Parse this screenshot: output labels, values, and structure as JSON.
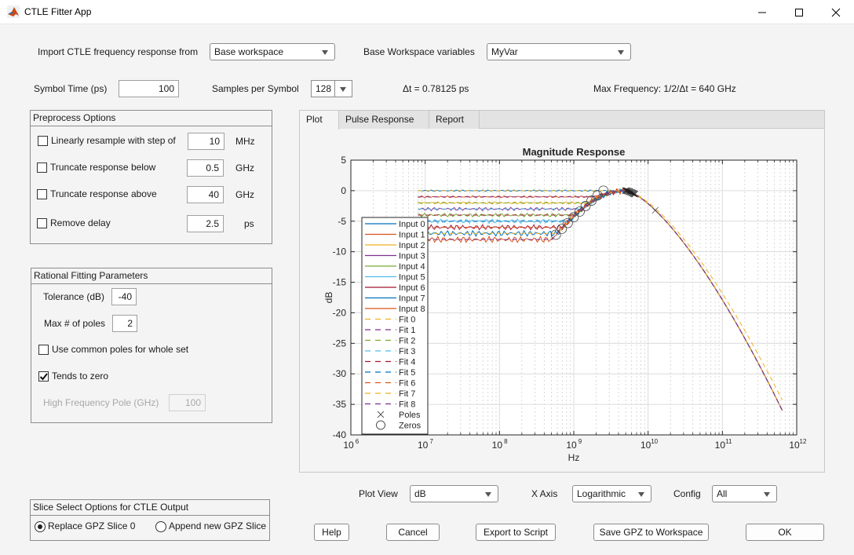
{
  "window": {
    "title": "CTLE Fitter App",
    "icon": "matlab-logo-icon",
    "controls": {
      "minimize": "minimize-icon",
      "maximize": "maximize-icon",
      "close": "close-icon"
    }
  },
  "import": {
    "label": "Import CTLE frequency response from",
    "source_value": "Base workspace",
    "variables_label": "Base Workspace variables",
    "variables_value": "MyVar"
  },
  "symbol": {
    "time_label": "Symbol Time (ps)",
    "time_value": "100",
    "samples_label": "Samples per Symbol",
    "samples_value": "128",
    "delta_t": "Δt = 0.78125 ps",
    "max_freq": "Max Frequency: 1/2/Δt = 640 GHz"
  },
  "preprocess": {
    "title": "Preprocess Options",
    "options": [
      {
        "label": "Linearly resample with step of",
        "checked": false,
        "value": "10",
        "unit": "MHz"
      },
      {
        "label": "Truncate response below",
        "checked": false,
        "value": "0.5",
        "unit": "GHz"
      },
      {
        "label": "Truncate response above",
        "checked": false,
        "value": "40",
        "unit": "GHz"
      },
      {
        "label": "Remove delay",
        "checked": false,
        "value": "2.5",
        "unit": "ps"
      }
    ]
  },
  "rational": {
    "title": "Rational Fitting Parameters",
    "tolerance_label": "Tolerance (dB)",
    "tolerance_value": "-40",
    "maxpoles_label": "Max # of poles",
    "maxpoles_value": "2",
    "common_poles_label": "Use common poles for whole set",
    "common_poles_checked": false,
    "tends_zero_label": "Tends to zero",
    "tends_zero_checked": true,
    "hf_pole_label": "High Frequency Pole (GHz)",
    "hf_pole_value": "100"
  },
  "slice": {
    "title": "Slice Select Options for CTLE Output",
    "options": [
      {
        "label": "Replace GPZ Slice 0",
        "selected": true
      },
      {
        "label": "Append new GPZ Slice",
        "selected": false
      }
    ]
  },
  "tabs": [
    {
      "label": "Plot",
      "active": true
    },
    {
      "label": "Pulse Response",
      "active": false
    },
    {
      "label": "Report",
      "active": false
    }
  ],
  "plot_controls": {
    "view_label": "Plot View",
    "view_value": "dB",
    "xaxis_label": "X Axis",
    "xaxis_value": "Logarithmic",
    "config_label": "Config",
    "config_value": "All"
  },
  "buttons": {
    "help": "Help",
    "cancel": "Cancel",
    "export": "Export to Script",
    "save": "Save GPZ to Workspace",
    "ok": "OK"
  },
  "chart_data": {
    "type": "line",
    "title": "Magnitude Response",
    "xlabel": "Hz",
    "ylabel": "dB",
    "xscale": "log",
    "xlim": [
      1000000.0,
      1000000000000.0
    ],
    "ylim": [
      -40,
      5
    ],
    "xticks": [
      {
        "exp": "6",
        "value": 1000000.0
      },
      {
        "exp": "7",
        "value": 10000000.0
      },
      {
        "exp": "8",
        "value": 100000000.0
      },
      {
        "exp": "9",
        "value": 1000000000.0
      },
      {
        "exp": "10",
        "value": 10000000000.0
      },
      {
        "exp": "11",
        "value": 100000000000.0
      },
      {
        "exp": "12",
        "value": 1000000000000.0
      }
    ],
    "yticks": [
      5,
      0,
      -5,
      -10,
      -15,
      -20,
      -25,
      -30,
      -35,
      -40
    ],
    "grid": true,
    "legend_position": "left",
    "f_start": 8000000.0,
    "f_end": 640000000000.0,
    "peak_freq": 5000000000.0,
    "peak_db": 0,
    "end_db": -36,
    "series": [
      {
        "name": "Input 0",
        "style": "solid",
        "color": "#0072BD",
        "dc_db": 0
      },
      {
        "name": "Input 1",
        "style": "solid",
        "color": "#D95319",
        "dc_db": -1
      },
      {
        "name": "Input 2",
        "style": "solid",
        "color": "#EDB120",
        "dc_db": -2
      },
      {
        "name": "Input 3",
        "style": "solid",
        "color": "#7E2F8E",
        "dc_db": -3
      },
      {
        "name": "Input 4",
        "style": "solid",
        "color": "#77AC30",
        "dc_db": -4
      },
      {
        "name": "Input 5",
        "style": "solid",
        "color": "#4DBEEE",
        "dc_db": -5
      },
      {
        "name": "Input 6",
        "style": "solid",
        "color": "#A2142F",
        "dc_db": -6
      },
      {
        "name": "Input 7",
        "style": "solid",
        "color": "#0072BD",
        "dc_db": -7
      },
      {
        "name": "Input 8",
        "style": "solid",
        "color": "#D95319",
        "dc_db": -8
      },
      {
        "name": "Fit 0",
        "style": "dashed",
        "color": "#EDB120",
        "dc_db": 0
      },
      {
        "name": "Fit 1",
        "style": "dashed",
        "color": "#7E2F8E",
        "dc_db": -1
      },
      {
        "name": "Fit 2",
        "style": "dashed",
        "color": "#77AC30",
        "dc_db": -2
      },
      {
        "name": "Fit 3",
        "style": "dashed",
        "color": "#4DBEEE",
        "dc_db": -3
      },
      {
        "name": "Fit 4",
        "style": "dashed",
        "color": "#A2142F",
        "dc_db": -4
      },
      {
        "name": "Fit 5",
        "style": "dashed",
        "color": "#0072BD",
        "dc_db": -5
      },
      {
        "name": "Fit 6",
        "style": "dashed",
        "color": "#D95319",
        "dc_db": -6
      },
      {
        "name": "Fit 7",
        "style": "dashed",
        "color": "#EDB120",
        "dc_db": -7
      },
      {
        "name": "Fit 8",
        "style": "dashed",
        "color": "#7E2F8E",
        "dc_db": -8
      }
    ],
    "markers": [
      {
        "name": "Poles",
        "symbol": "x"
      },
      {
        "name": "Zeros",
        "symbol": "o"
      }
    ]
  }
}
